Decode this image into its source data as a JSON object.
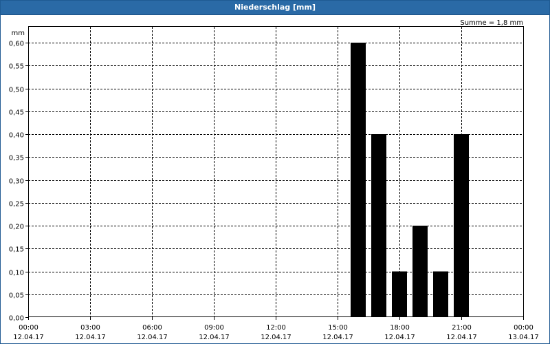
{
  "window": {
    "title": "Niederschlag [mm]"
  },
  "chart_data": {
    "type": "bar",
    "title": "Niederschlag [mm]",
    "unit": "mm",
    "summary": "Summe = 1,8 mm",
    "ylim": [
      0,
      0.6
    ],
    "y_ticks": [
      "0,00",
      "0,05",
      "0,10",
      "0,15",
      "0,20",
      "0,25",
      "0,30",
      "0,35",
      "0,40",
      "0,45",
      "0,50",
      "0,55",
      "0,60"
    ],
    "xlim_hours": [
      0,
      24
    ],
    "x_ticks": [
      {
        "time": "00:00",
        "date": "12.04.17"
      },
      {
        "time": "03:00",
        "date": "12.04.17"
      },
      {
        "time": "06:00",
        "date": "12.04.17"
      },
      {
        "time": "09:00",
        "date": "12.04.17"
      },
      {
        "time": "12:00",
        "date": "12.04.17"
      },
      {
        "time": "15:00",
        "date": "12.04.17"
      },
      {
        "time": "18:00",
        "date": "12.04.17"
      },
      {
        "time": "21:00",
        "date": "12.04.17"
      },
      {
        "time": "00:00",
        "date": "13.04.17"
      }
    ],
    "bars": [
      {
        "hour": 16,
        "value": 0.6
      },
      {
        "hour": 17,
        "value": 0.4
      },
      {
        "hour": 18,
        "value": 0.1
      },
      {
        "hour": 19,
        "value": 0.2
      },
      {
        "hour": 20,
        "value": 0.1
      },
      {
        "hour": 21,
        "value": 0.4
      }
    ],
    "grid": true,
    "bar_color": "#000000"
  }
}
